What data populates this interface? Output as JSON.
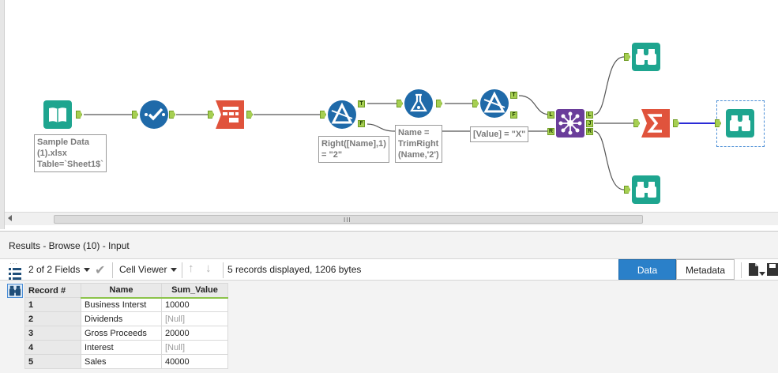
{
  "canvas": {
    "annotations": {
      "input": "Sample Data\n(1).xlsx\nTable=`Sheet1$`",
      "filter1": "Right([Name],1)\n= \"2\"",
      "formula": "Name =\nTrimRight\n(Name,'2')",
      "filter2": "[Value] = \"X\""
    },
    "anchor_labels": {
      "true": "T",
      "false": "F",
      "left": "L",
      "join": "J",
      "right": "R"
    },
    "scrollbar_grip": "III"
  },
  "results": {
    "title": "Results - Browse (10) - Input",
    "toolbar": {
      "fields_label": "2 of 2 Fields",
      "viewer_label": "Cell Viewer",
      "records_info": "5 records displayed, 1206 bytes",
      "data_tab": "Data",
      "metadata_tab": "Metadata"
    },
    "columns": [
      "Record #",
      "Name",
      "Sum_Value"
    ],
    "rows": [
      {
        "record": "1",
        "name": "Business Interst",
        "value": "10000"
      },
      {
        "record": "2",
        "name": "Dividends",
        "value": "[Null]"
      },
      {
        "record": "3",
        "name": "Gross Proceeds",
        "value": "20000"
      },
      {
        "record": "4",
        "name": "Interest",
        "value": "[Null]"
      },
      {
        "record": "5",
        "name": "Sales",
        "value": "40000"
      }
    ]
  },
  "colors": {
    "input_tool": "#1ea58f",
    "prep_tool": "#1f6aa9",
    "parse_tool": "#e0533c",
    "join_tool": "#6a3d9a",
    "summarize_tool": "#e0533c",
    "browse_tool": "#1ea58f",
    "data_tab_active": "#2a80c9"
  }
}
